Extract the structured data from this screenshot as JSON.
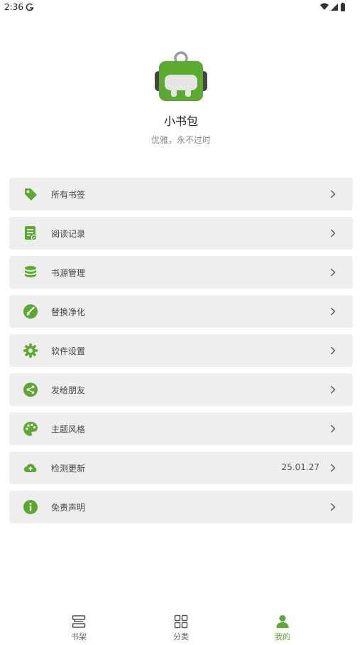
{
  "status_bar": {
    "time": "2:36"
  },
  "profile": {
    "name": "小书包",
    "slogan": "优雅，永不过时"
  },
  "menu": [
    {
      "label": "所有书签",
      "icon": "tag-icon"
    },
    {
      "label": "阅读记录",
      "icon": "reading-record-icon"
    },
    {
      "label": "书源管理",
      "icon": "database-icon"
    },
    {
      "label": "替换净化",
      "icon": "brush-icon"
    },
    {
      "label": "软件设置",
      "icon": "gear-icon"
    },
    {
      "label": "发给朋友",
      "icon": "share-icon"
    },
    {
      "label": "主题风格",
      "icon": "palette-icon"
    },
    {
      "label": "检测更新",
      "icon": "cloud-upload-icon",
      "value": "25.01.27"
    },
    {
      "label": "免责声明",
      "icon": "info-icon"
    }
  ],
  "bottom_nav": [
    {
      "label": "书架",
      "icon": "bookshelf-icon",
      "active": false
    },
    {
      "label": "分类",
      "icon": "grid-icon",
      "active": false
    },
    {
      "label": "我的",
      "icon": "person-icon",
      "active": true
    }
  ],
  "colors": {
    "accent": "#5aaa2e",
    "card_bg": "#eeeeee"
  }
}
